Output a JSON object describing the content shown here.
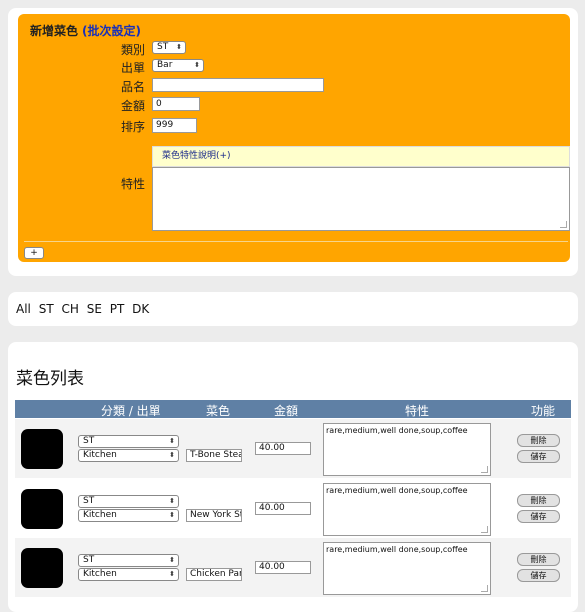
{
  "form": {
    "title": "新增菜色",
    "batch_link": "(批次設定)",
    "category_label": "類別",
    "category_value": "ST",
    "output_label": "出單",
    "output_value": "Bar",
    "name_label": "品名",
    "name_value": "",
    "price_label": "金額",
    "price_value": "0",
    "sort_label": "排序",
    "sort_value": "999",
    "traits_label": "特性",
    "traits_header": "菜色特性說明(+)",
    "add_label": "+"
  },
  "filters": [
    "All",
    "ST",
    "CH",
    "SE",
    "PT",
    "DK"
  ],
  "list": {
    "title": "菜色列表",
    "headers": {
      "category_output": "分類 / 出單",
      "dish": "菜色",
      "price": "金額",
      "traits": "特性",
      "actions": "功能"
    },
    "delete_label": "刪除",
    "save_label": "儲存",
    "rows": [
      {
        "category": "ST",
        "output": "Kitchen",
        "name": "T-Bone Steak",
        "price": "40.00",
        "traits": "rare,medium,well done,soup,coffee"
      },
      {
        "category": "ST",
        "output": "Kitchen",
        "name": "New York Steak",
        "price": "40.00",
        "traits": "rare,medium,well done,soup,coffee"
      },
      {
        "category": "ST",
        "output": "Kitchen",
        "name": "Chicken Parmesan",
        "price": "40.00",
        "traits": "rare,medium,well done,soup,coffee"
      }
    ]
  }
}
